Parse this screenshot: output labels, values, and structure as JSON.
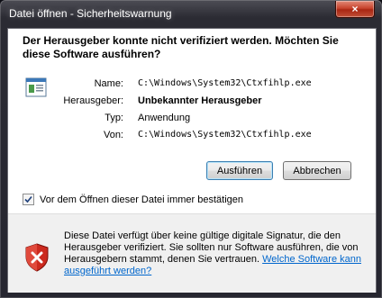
{
  "window": {
    "title": "Datei öffnen - Sicherheitswarnung",
    "close_label": "×"
  },
  "dialog": {
    "heading": "Der Herausgeber konnte nicht verifiziert werden. Möchten Sie diese Software ausführen?",
    "rows": [
      {
        "label": "Name:",
        "value": "C:\\Windows\\System32\\Ctxfihlp.exe"
      },
      {
        "label": "Herausgeber:",
        "value": "Unbekannter Herausgeber"
      },
      {
        "label": "Typ:",
        "value": "Anwendung"
      },
      {
        "label": "Von:",
        "value": "C:\\Windows\\System32\\Ctxfihlp.exe"
      }
    ],
    "buttons": {
      "run": "Ausführen",
      "cancel": "Abbrechen"
    },
    "checkbox": {
      "label": "Vor dem Öffnen dieser Datei immer bestätigen",
      "checked": true
    },
    "footer": {
      "text": "Diese Datei verfügt über keine gültige digitale Signatur, die den Herausgeber verifiziert. Sie sollten nur Software ausführen, die von Herausgebern stammt, denen Sie vertrauen. ",
      "link": "Welche Software kann ausgeführt werden?"
    }
  },
  "icons": {
    "file": "application-file-icon",
    "shield": "security-warning-shield-icon",
    "close": "close-icon",
    "check": "checkmark-icon"
  }
}
